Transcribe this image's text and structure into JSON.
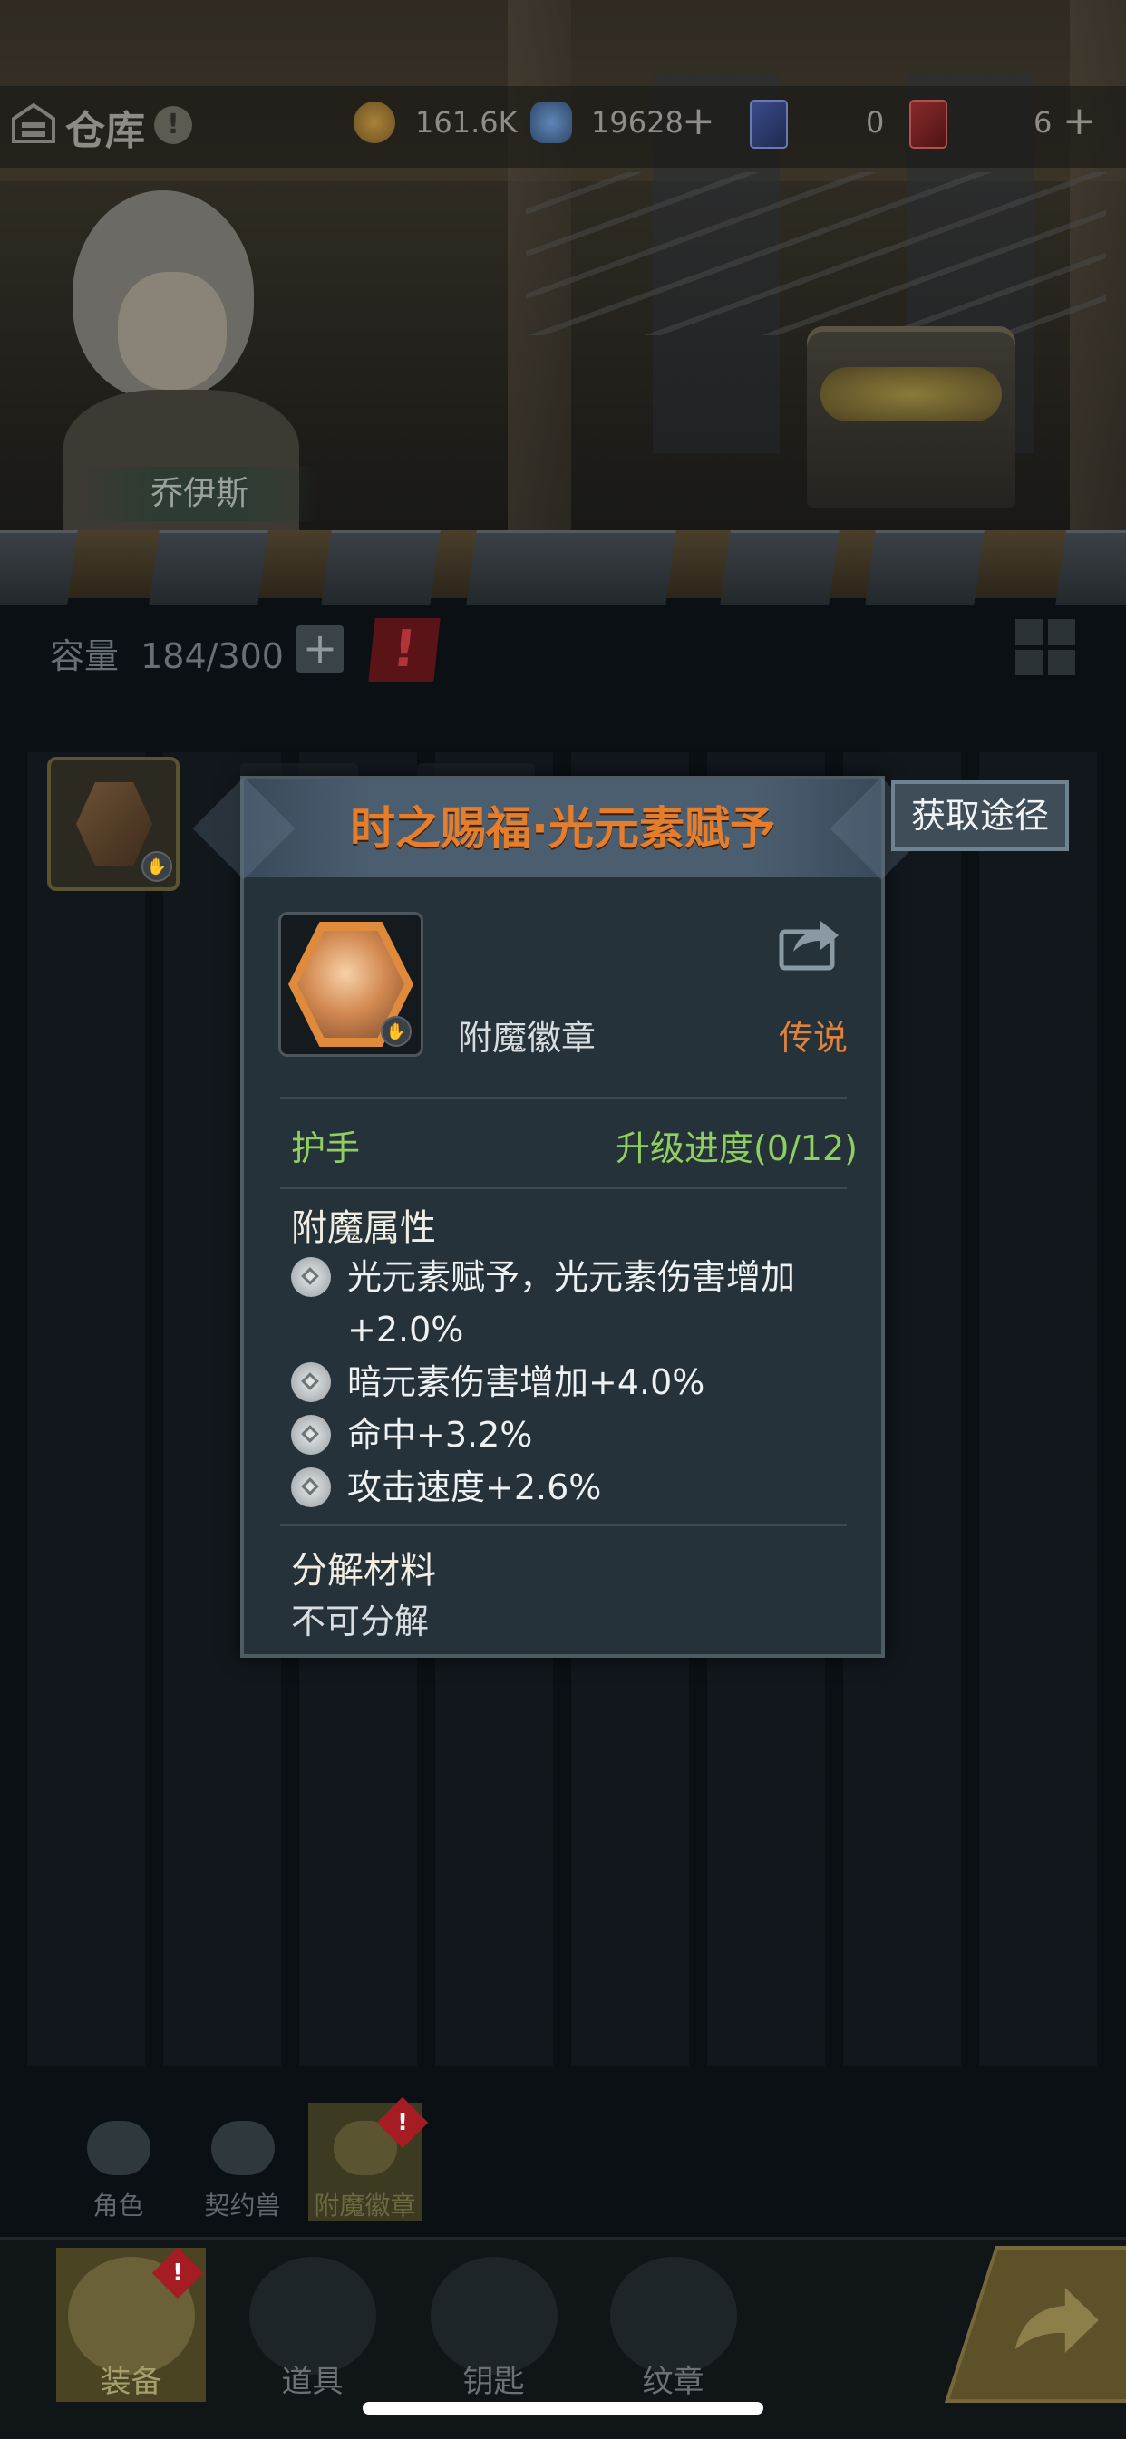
{
  "topbar": {
    "title": "仓库",
    "info_mark": "!",
    "coins": "161.6K",
    "gems": "19628",
    "card_blue_count": "0",
    "card_red_count": "6"
  },
  "hero": {
    "name": "乔伊斯"
  },
  "inventory": {
    "capacity_label": "容量",
    "capacity_value": "184/300",
    "plus_symbol": "+"
  },
  "popup": {
    "title": "时之赐福·光元素赋予",
    "item_type": "附魔徽章",
    "rarity": "传说",
    "slot": "护手",
    "upgrade": "升级进度(0/12)",
    "attributes_title": "附魔属性",
    "attributes": [
      "光元素赋予，光元素伤害增加",
      "+2.0%",
      "暗元素伤害增加+4.0%",
      "命中+3.2%",
      "攻击速度+2.6%"
    ],
    "decompose_title": "分解材料",
    "decompose_value": "不可分解"
  },
  "source_button": "获取途径",
  "subtabs": [
    "角色",
    "契约兽",
    "附魔徽章"
  ],
  "alert_mark": "!",
  "nav": [
    "装备",
    "道具",
    "钥匙",
    "纹章"
  ],
  "colors": {
    "title_orange": "#e47d2c",
    "legend_orange": "#e0823a",
    "green": "#8fcf5f",
    "alert_red": "#a51c22"
  }
}
